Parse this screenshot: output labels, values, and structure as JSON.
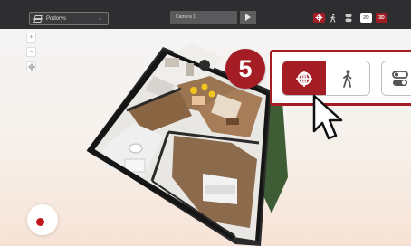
{
  "toolbar": {
    "floor_label": "Podorys",
    "camera_label": "Camera 1",
    "view_2d": "2D",
    "view_3d": "3D"
  },
  "left_tools": {
    "zoom_in": "+",
    "zoom_out": "−"
  },
  "callout": {
    "number": "5"
  },
  "icons": {
    "floor": "layers-icon",
    "play": "play-icon",
    "orbit": "orbit-icon",
    "walk": "walk-icon",
    "toggle": "toggle-icon",
    "cursor": "cursor-icon",
    "record": "record-icon"
  },
  "colors": {
    "accent": "#a51d24",
    "toolbar_bg": "#2e2e30"
  }
}
